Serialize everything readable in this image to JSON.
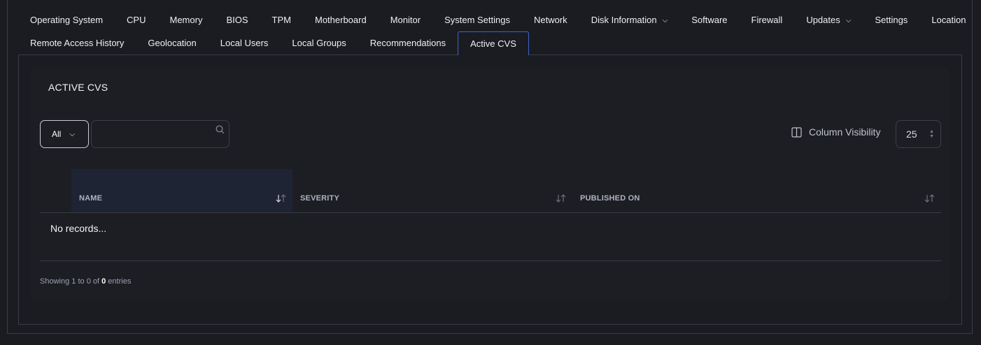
{
  "tabs": {
    "row1": [
      {
        "label": "Operating System"
      },
      {
        "label": "CPU"
      },
      {
        "label": "Memory"
      },
      {
        "label": "BIOS"
      },
      {
        "label": "TPM"
      },
      {
        "label": "Motherboard"
      },
      {
        "label": "Monitor"
      },
      {
        "label": "System Settings"
      },
      {
        "label": "Network"
      },
      {
        "label": "Disk Information",
        "dropdown": true
      },
      {
        "label": "Software"
      },
      {
        "label": "Firewall"
      },
      {
        "label": "Updates",
        "dropdown": true
      },
      {
        "label": "Settings"
      },
      {
        "label": "Location"
      }
    ],
    "row2": [
      {
        "label": "Remote Access History"
      },
      {
        "label": "Geolocation"
      },
      {
        "label": "Local Users"
      },
      {
        "label": "Local Groups"
      },
      {
        "label": "Recommendations"
      },
      {
        "label": "Active CVS",
        "active": true
      }
    ]
  },
  "card": {
    "title": "ACTIVE CVS",
    "filter_value": "All",
    "search_placeholder": "",
    "column_visibility_label": "Column Visibility",
    "page_size": "25"
  },
  "table": {
    "columns": [
      "NAME",
      "SEVERITY",
      "PUBLISHED ON"
    ],
    "empty_text": "No records...",
    "footer": {
      "prefix": "Showing",
      "from": "1",
      "to": "0",
      "total": "0",
      "suffix": "entries"
    }
  },
  "colors": {
    "accent_border": "#3e64c8",
    "sorted_header_bg": "#1f2434",
    "background": "#1b1c22"
  }
}
